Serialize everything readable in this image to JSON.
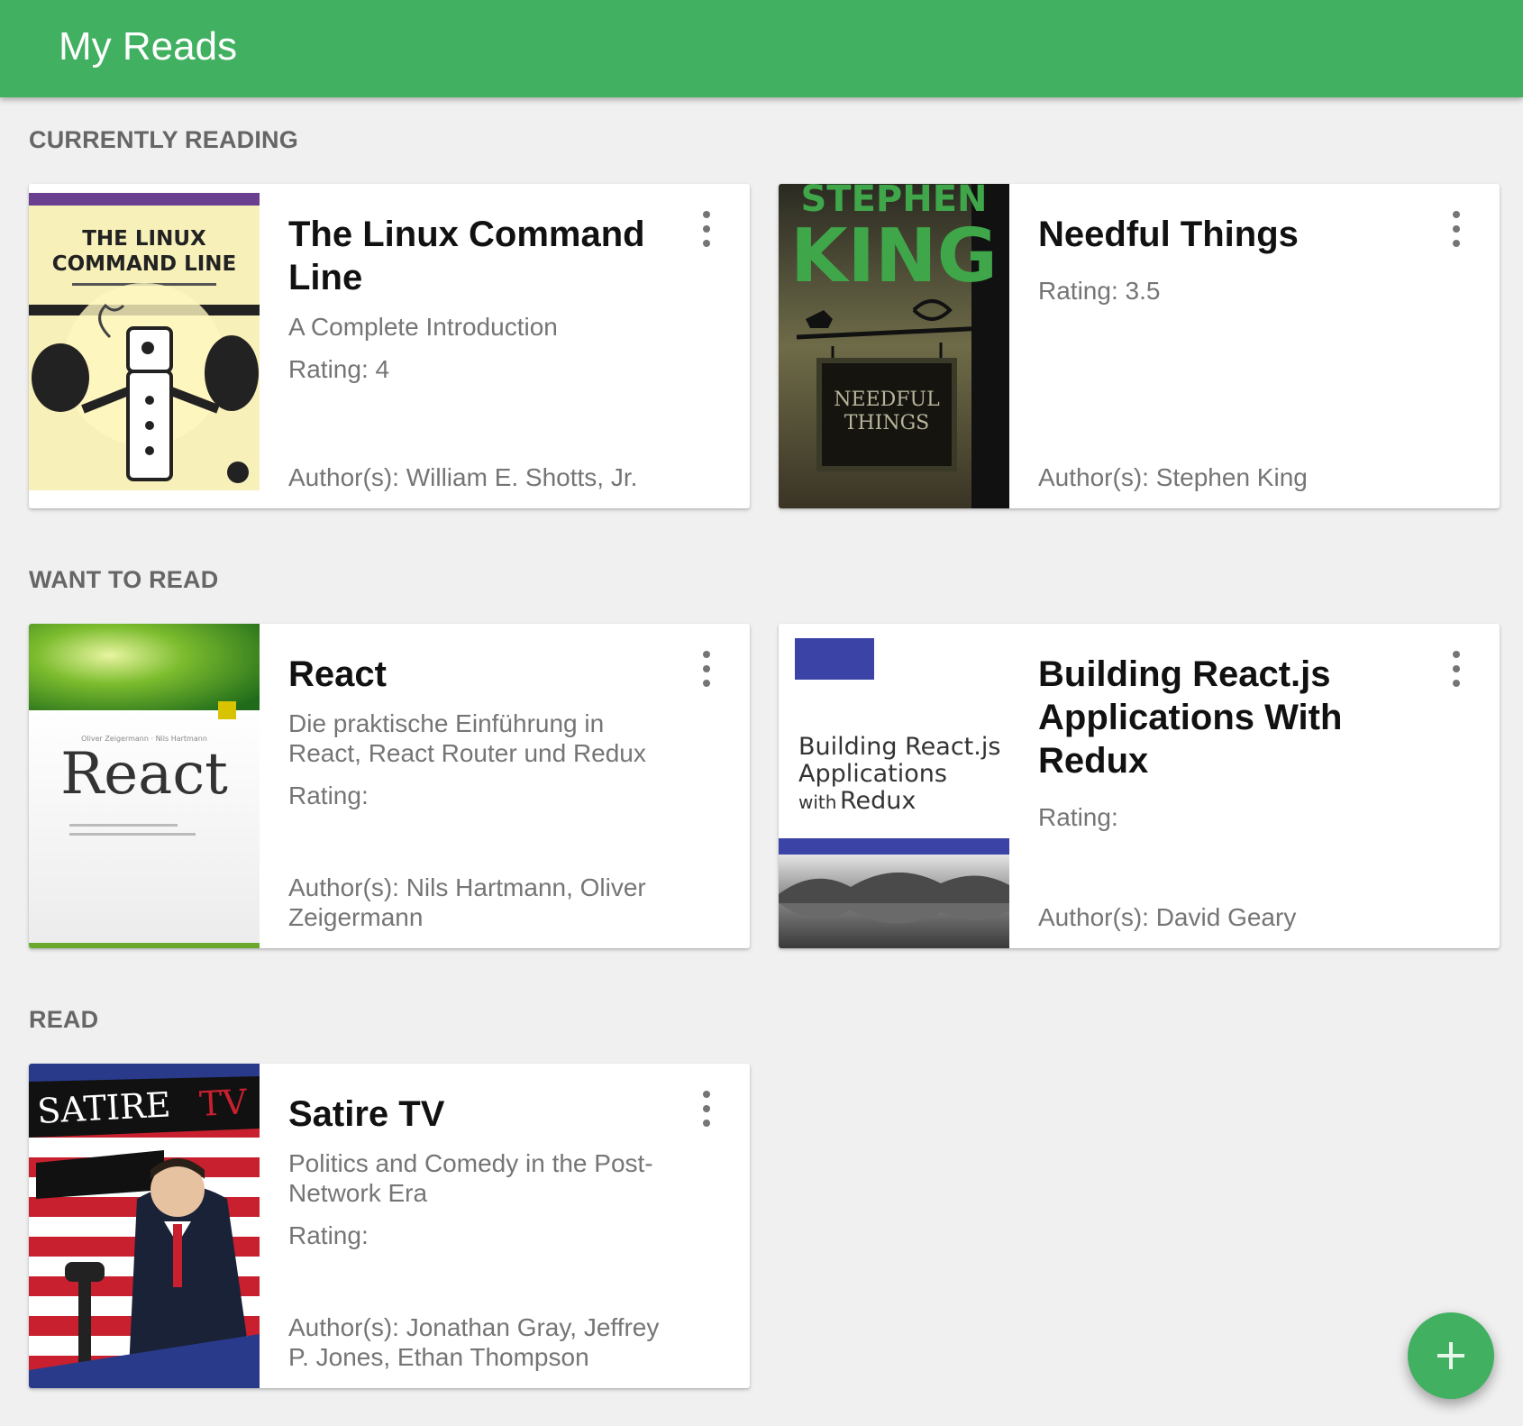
{
  "app": {
    "title": "My Reads"
  },
  "shelves": [
    {
      "title": "CURRENTLY READING",
      "books": [
        {
          "title": "The Linux Command Line",
          "subtitle": "A Complete Introduction",
          "rating": "Rating: 4",
          "authors": "Author(s): William E. Shotts, Jr.",
          "cover_icon": "cover-linux-command-line"
        },
        {
          "title": "Needful Things",
          "subtitle": "",
          "rating": "Rating: 3.5",
          "authors": "Author(s): Stephen King",
          "cover_icon": "cover-needful-things"
        }
      ]
    },
    {
      "title": "WANT TO READ",
      "books": [
        {
          "title": "React",
          "subtitle": "Die praktische Einführung in React, React Router und Redux",
          "rating": "Rating:",
          "authors": "Author(s): Nils Hartmann, Oliver Zeigermann",
          "cover_icon": "cover-react"
        },
        {
          "title": "Building React.js Applications With Redux",
          "subtitle": "",
          "rating": "Rating:",
          "authors": "Author(s): David Geary",
          "cover_icon": "cover-building-react"
        }
      ]
    },
    {
      "title": "READ",
      "books": [
        {
          "title": "Satire TV",
          "subtitle": "Politics and Comedy in the Post-Network Era",
          "rating": "Rating:",
          "authors": "Author(s): Jonathan Gray, Jeffrey P. Jones, Ethan Thompson",
          "cover_icon": "cover-satire-tv"
        }
      ]
    }
  ],
  "covers": {
    "linux": {
      "line1": "THE LINUX",
      "line2": "COMMAND LINE"
    },
    "king": {
      "line1": "STEPHEN",
      "line2": "KING",
      "sign1": "NEEDFUL",
      "sign2": "THINGS"
    },
    "react": {
      "big": "React"
    },
    "building": {
      "line1": "Building React.js",
      "line2": "Applications",
      "line3a": "with",
      "line3b": "Redux"
    },
    "satire": {
      "line1": "SATIRE",
      "line2": "TV"
    }
  },
  "fab": {
    "icon": "plus-icon",
    "label": "+"
  },
  "colors": {
    "appbar": "#41b060",
    "background": "#f0f0f0",
    "fab": "#41b060"
  }
}
